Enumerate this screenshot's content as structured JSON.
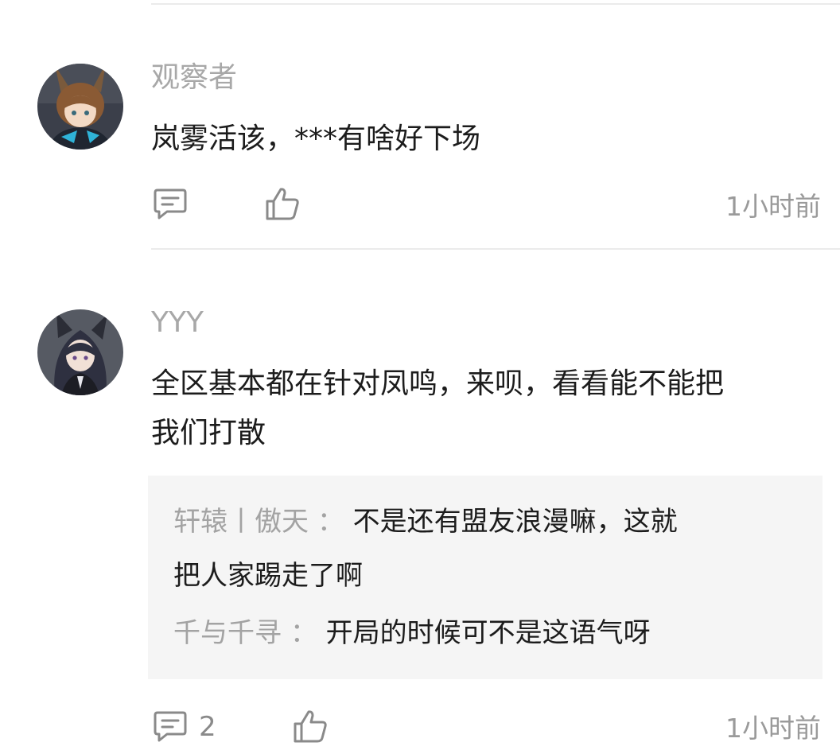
{
  "comments": [
    {
      "username": "观察者",
      "avatar_icon": "anime-avatar-bunny-ears-icon",
      "text": "岚雾活该，***有啥好下场",
      "comment_count": "",
      "time": "1小时前"
    },
    {
      "username": "YYY",
      "avatar_icon": "anime-avatar-wolf-ears-icon",
      "text_line1": "全区基本都在针对凤鸣，来呗，看看能不能把",
      "text_line2": "我们打散",
      "replies": [
        {
          "name": "轩辕丨傲天",
          "separator": "：",
          "text_line1": "不是还有盟友浪漫嘛，这就",
          "text_line2": "把人家踢走了啊"
        },
        {
          "name": "千与千寻",
          "separator": "：",
          "text_line1": "开局的时候可不是这语气呀"
        }
      ],
      "comment_count": "2",
      "time": "1小时前"
    }
  ],
  "icons": {
    "comment": "comment-icon",
    "like": "thumbs-up-icon"
  },
  "colors": {
    "username": "#a8a8a8",
    "text": "#1c1c1c",
    "reply_background": "#f5f5f5",
    "meta": "#8a8a8a"
  }
}
